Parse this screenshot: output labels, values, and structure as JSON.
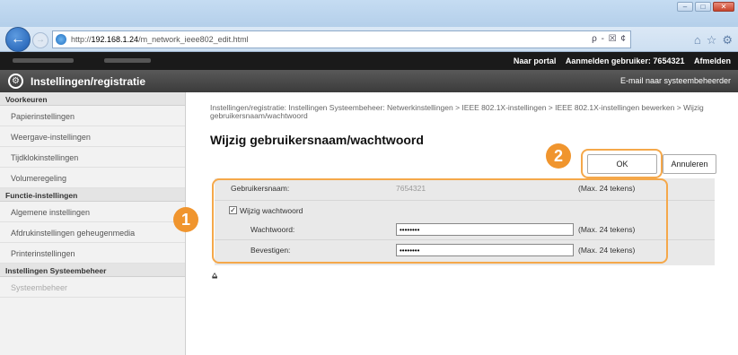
{
  "browser": {
    "window_controls": [
      "–",
      "□",
      "✕"
    ],
    "url_prefix": "http://",
    "url_host": "192.168.1.24",
    "url_path": "/m_network_ieee802_edit.html",
    "addr_tools": "ρ - ☒ ¢",
    "icons": [
      "home-icon",
      "star-icon",
      "gear-icon"
    ]
  },
  "topbar": {
    "portal": "Naar portal",
    "login_user_label": "Aanmelden gebruiker: 7654321",
    "logout": "Afmelden"
  },
  "appbar": {
    "title": "Instellingen/registratie",
    "mail": "E-mail naar systeembeheerder"
  },
  "sidebar": {
    "sections": [
      {
        "head": "Voorkeuren",
        "items": [
          "Papierinstellingen",
          "Weergave-instellingen",
          "Tijdklokinstellingen",
          "Volumeregeling"
        ]
      },
      {
        "head": "Functie-instellingen",
        "items": [
          "Algemene instellingen",
          "Afdrukinstellingen geheugenmedia",
          "Printerinstellingen"
        ]
      },
      {
        "head": "Instellingen Systeembeheer",
        "items": [
          "Systeembeheer"
        ]
      }
    ]
  },
  "main": {
    "breadcrumb": "Instellingen/registratie: Instellingen Systeembeheer: Netwerkinstellingen > IEEE 802.1X-instellingen > IEEE 802.1X-instellingen bewerken > Wijzig gebruikersnaam/wachtwoord",
    "title": "Wijzig gebruikersnaam/wachtwoord",
    "ok": "OK",
    "cancel": "Annuleren",
    "callout_1": "1",
    "callout_2": "2",
    "username_label": "Gebruikersnaam:",
    "username_value": "7654321",
    "username_hint": "(Max. 24 tekens)",
    "change_password_label": "Wijzig wachtwoord",
    "password_label": "Wachtwoord:",
    "password_value": "••••••••",
    "password_hint": "(Max. 24 tekens)",
    "confirm_label": "Bevestigen:",
    "confirm_value": "••••••••",
    "confirm_hint": "(Max. 24 tekens)",
    "to_top": "⩠"
  },
  "colors": {
    "callout": "#f0952e",
    "highlight_border": "#f5a84a",
    "topbar": "#1a1a1a",
    "appbar": "#4a4a4a"
  }
}
